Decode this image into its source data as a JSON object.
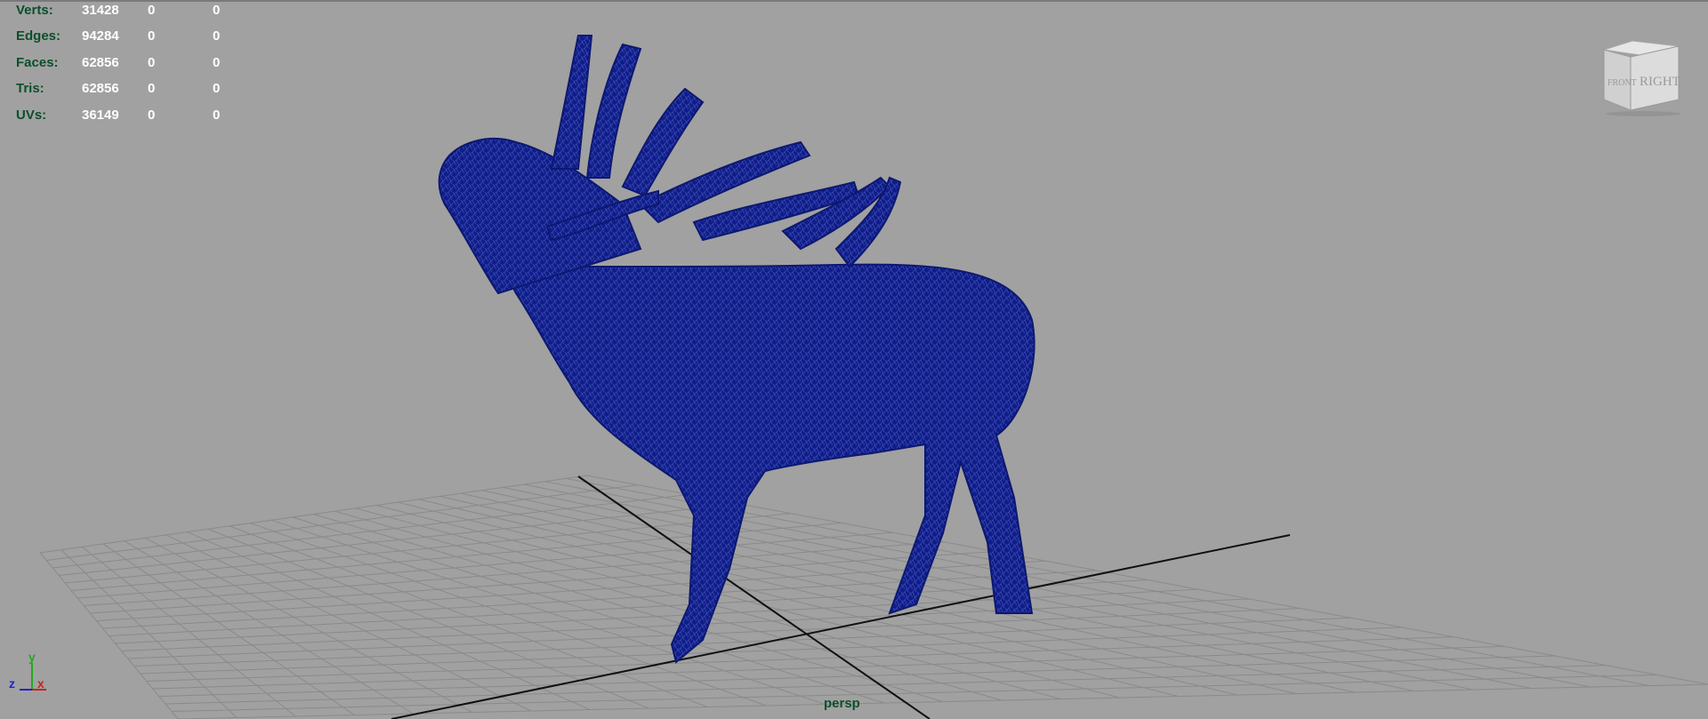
{
  "hud": {
    "rows": [
      {
        "label": "Verts:",
        "c1": "31428",
        "c2": "0",
        "c3": "0"
      },
      {
        "label": "Edges:",
        "c1": "94284",
        "c2": "0",
        "c3": "0"
      },
      {
        "label": "Faces:",
        "c1": "62856",
        "c2": "0",
        "c3": "0"
      },
      {
        "label": "Tris:",
        "c1": "62856",
        "c2": "0",
        "c3": "0"
      },
      {
        "label": "UVs:",
        "c1": "36149",
        "c2": "0",
        "c3": "0"
      }
    ]
  },
  "viewcube": {
    "face_right": "RIGHT",
    "face_front": "FRONT"
  },
  "axes": {
    "y": "y",
    "z": "z",
    "x": "x"
  },
  "camera_label": "persp",
  "colors": {
    "background": "#a1a1a1",
    "mesh": "#0f1e8a",
    "grid": "#8b8b8b",
    "hud_label": "#0b4f2b",
    "hud_value": "#ffffff"
  }
}
